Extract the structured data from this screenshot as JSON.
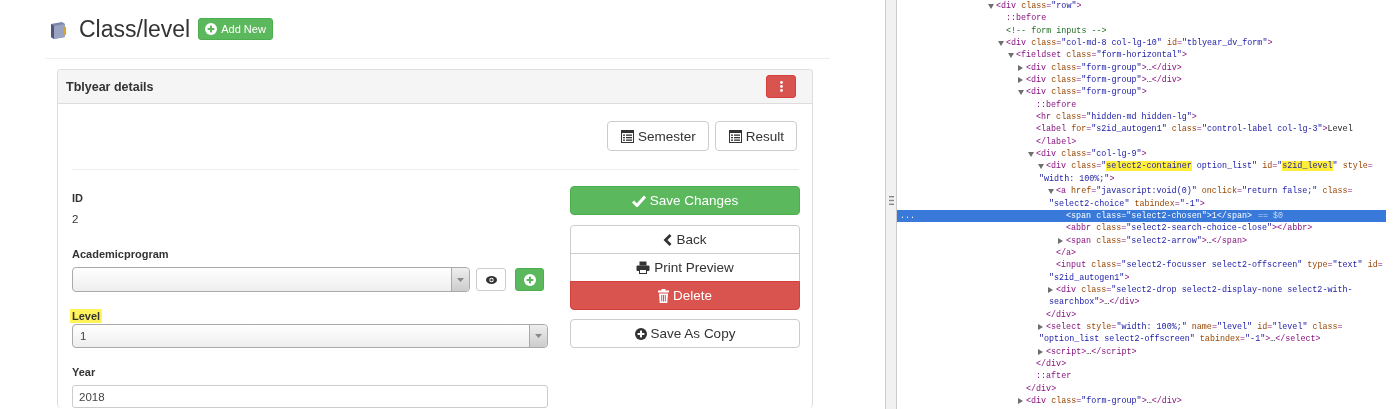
{
  "page": {
    "title": "Class/level",
    "add_button": "Add New"
  },
  "panel": {
    "title": "Tblyear details",
    "toolbar": [
      {
        "label": "Semester"
      },
      {
        "label": "Result"
      }
    ],
    "fields": [
      {
        "kind": "static",
        "label": "ID",
        "value": "2",
        "highlighted": false
      },
      {
        "kind": "select_with_actions",
        "label": "Academicprogram",
        "highlighted": false
      },
      {
        "kind": "select",
        "label": "Level",
        "value": "1",
        "highlighted": true
      },
      {
        "kind": "input",
        "label": "Year",
        "value": "2018",
        "highlighted": false
      }
    ],
    "actions": [
      {
        "kind": "save",
        "label": "Save Changes"
      },
      {
        "kind": "back",
        "label": "Back"
      },
      {
        "kind": "print",
        "label": "Print Preview"
      },
      {
        "kind": "delete",
        "label": "Delete"
      },
      {
        "kind": "copy",
        "label": "Save As Copy"
      }
    ]
  },
  "devtools": {
    "more_button": "...",
    "selected_marker": "== $0",
    "tree": [
      {
        "kind": "element",
        "open": "<div class=\"row\">",
        "expanded": true,
        "selected": false,
        "children": [
          {
            "kind": "pseudo",
            "open": "::before",
            "selected": false
          },
          {
            "kind": "comment",
            "open": "<!-- form inputs -->",
            "selected": false
          },
          {
            "kind": "element",
            "open": "<div class=\"col-md-8 col-lg-10\" id=\"tblyear_dv_form\">",
            "expanded": true,
            "selected": false,
            "children": [
              {
                "kind": "element",
                "open": "<fieldset class=\"form-horizontal\">",
                "expanded": true,
                "selected": false,
                "children": [
                  {
                    "kind": "element",
                    "open": "<div class=\"form-group\">…</div>",
                    "expanded": false,
                    "selected": false
                  },
                  {
                    "kind": "element",
                    "open": "<div class=\"form-group\">…</div>",
                    "expanded": false,
                    "selected": false
                  },
                  {
                    "kind": "element",
                    "open": "<div class=\"form-group\">",
                    "expanded": true,
                    "selected": false,
                    "close": "</div>",
                    "children": [
                      {
                        "kind": "pseudo",
                        "open": "::before",
                        "selected": false
                      },
                      {
                        "kind": "element",
                        "open": "<hr class=\"hidden-md hidden-lg\">",
                        "selected": false
                      },
                      {
                        "kind": "element",
                        "open": "<label for=\"s2id_autogen1\" class=\"control-label col-lg-3\">Level",
                        "selected": false,
                        "close": "</label>"
                      },
                      {
                        "kind": "element",
                        "open": "<div class=\"col-lg-9\">",
                        "expanded": true,
                        "selected": false,
                        "close": "</div>",
                        "children": [
                          {
                            "kind": "element",
                            "open": [
                              {
                                "text": "<div class=\"",
                                "highlight": false
                              },
                              {
                                "text": "select2-container",
                                "highlight": true
                              },
                              {
                                "text": " option_list\" id=\"",
                                "highlight": false
                              },
                              {
                                "text": "s2id_level",
                                "highlight": true
                              },
                              {
                                "text": "\" style=",
                                "highlight": false
                              }
                            ],
                            "wrap": "\"width: 100%;\">",
                            "expanded": true,
                            "selected": false,
                            "close": "</div>",
                            "children": [
                              {
                                "kind": "element",
                                "open": "<a href=\"javascript:void(0)\" onclick=\"return false;\" class=",
                                "wrap": "\"select2-choice\" tabindex=\"-1\">",
                                "expanded": true,
                                "selected": false,
                                "close": "</a>",
                                "children": [
                                  {
                                    "kind": "element",
                                    "open": "<span class=\"select2-chosen\">1</span>",
                                    "selected": true
                                  },
                                  {
                                    "kind": "element",
                                    "open": "<abbr class=\"select2-search-choice-close\"></abbr>",
                                    "selected": false
                                  },
                                  {
                                    "kind": "element",
                                    "open": "<span class=\"select2-arrow\">…</span>",
                                    "expanded": false,
                                    "selected": false
                                  }
                                ]
                              },
                              {
                                "kind": "element",
                                "open": "<input class=\"select2-focusser select2-offscreen\" type=\"text\" id=",
                                "wrap": "\"s2id_autogen1\">",
                                "selected": false
                              },
                              {
                                "kind": "element",
                                "open": "<div class=\"select2-drop select2-display-none select2-with-",
                                "wrap": "searchbox\">…</div>",
                                "expanded": false,
                                "selected": false
                              }
                            ]
                          },
                          {
                            "kind": "element",
                            "open": "<select style=\"width: 100%;\" name=\"level\" id=\"level\" class=",
                            "wrap": "\"option_list select2-offscreen\" tabindex=\"-1\">…</select>",
                            "expanded": false,
                            "selected": false
                          },
                          {
                            "kind": "element",
                            "open": "<script>…</script>",
                            "expanded": false,
                            "selected": false
                          }
                        ]
                      },
                      {
                        "kind": "pseudo",
                        "open": "::after",
                        "selected": false
                      }
                    ]
                  },
                  {
                    "kind": "element",
                    "open": "<div class=\"form-group\">…</div>",
                    "expanded": false,
                    "selected": false
                  }
                ]
              }
            ]
          }
        ]
      }
    ]
  }
}
